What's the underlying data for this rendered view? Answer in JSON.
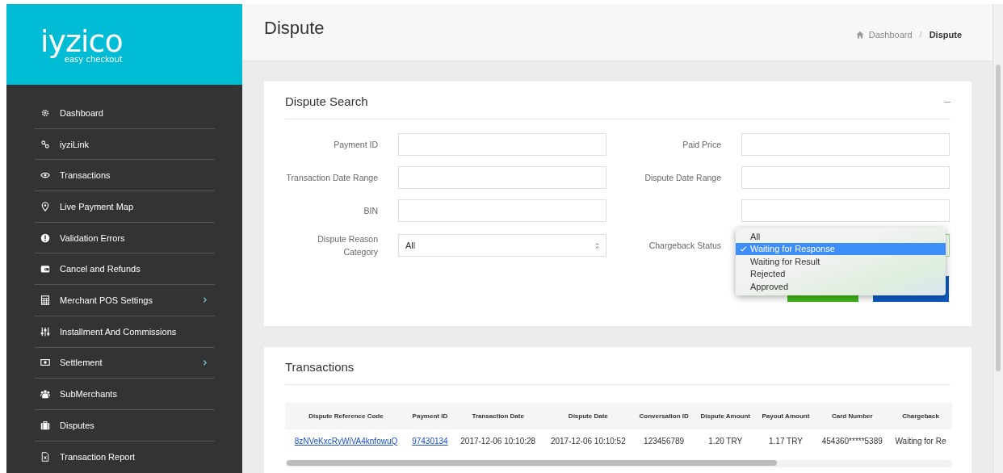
{
  "logo": {
    "name": "iyzico",
    "tagline": "easy checkout"
  },
  "sidebar": {
    "items": [
      {
        "label": "Dashboard",
        "has_submenu": false
      },
      {
        "label": "iyziLink",
        "has_submenu": false
      },
      {
        "label": "Transactions",
        "has_submenu": false
      },
      {
        "label": "Live Payment Map",
        "has_submenu": false
      },
      {
        "label": "Validation Errors",
        "has_submenu": false
      },
      {
        "label": "Cancel and Refunds",
        "has_submenu": false
      },
      {
        "label": "Merchant POS Settings",
        "has_submenu": true
      },
      {
        "label": "Installment And Commissions",
        "has_submenu": false
      },
      {
        "label": "Settlement",
        "has_submenu": true
      },
      {
        "label": "SubMerchants",
        "has_submenu": false
      },
      {
        "label": "Disputes",
        "has_submenu": false
      },
      {
        "label": "Transaction Report",
        "has_submenu": false
      }
    ]
  },
  "header": {
    "title": "Dispute",
    "breadcrumb_separator": "/",
    "breadcrumb": [
      {
        "label": "Dashboard",
        "current": false
      },
      {
        "label": "Dispute",
        "current": true
      }
    ]
  },
  "search_card": {
    "title": "Dispute Search",
    "collapse": "–",
    "fields": [
      {
        "label": "Payment ID",
        "kind": "input"
      },
      {
        "label": "Paid Price",
        "kind": "input"
      },
      {
        "label": "Transaction Date Range",
        "kind": "input"
      },
      {
        "label": "Dispute Date Range",
        "kind": "input"
      },
      {
        "label": "BIN",
        "kind": "input"
      },
      {
        "kind": "input"
      },
      {
        "label": "Dispute Reason Category",
        "kind": "select",
        "value": "All"
      },
      {
        "label": "Chargeback Status",
        "kind": "select",
        "open": true
      }
    ],
    "dropdown": [
      {
        "label": "All",
        "selected": false
      },
      {
        "label": "Waiting for Response",
        "selected": true
      },
      {
        "label": "Waiting for Result",
        "selected": false
      },
      {
        "label": "Rejected",
        "selected": false
      },
      {
        "label": "Approved",
        "selected": false
      }
    ],
    "buttons": [
      {
        "color": "#3fb618"
      },
      {
        "color": "#0d5bc4"
      }
    ]
  },
  "transactions": {
    "title": "Transactions",
    "columns": [
      "Dispute Reference Code",
      "Payment ID",
      "Transaction Date",
      "Dispute Date",
      "Conversation ID",
      "Dispute Amount",
      "Payout Amount",
      "Card Number",
      "Chargeback"
    ],
    "rows": [
      [
        "8zNVeKxcRyWiVA4knfowuQ",
        "97430134",
        "2017-12-06 10:10:28",
        "2017-12-06 10:10:52",
        "123456789",
        "1.20 TRY",
        "1.17 TRY",
        "454360*****5389",
        "Waiting for Re"
      ]
    ]
  }
}
